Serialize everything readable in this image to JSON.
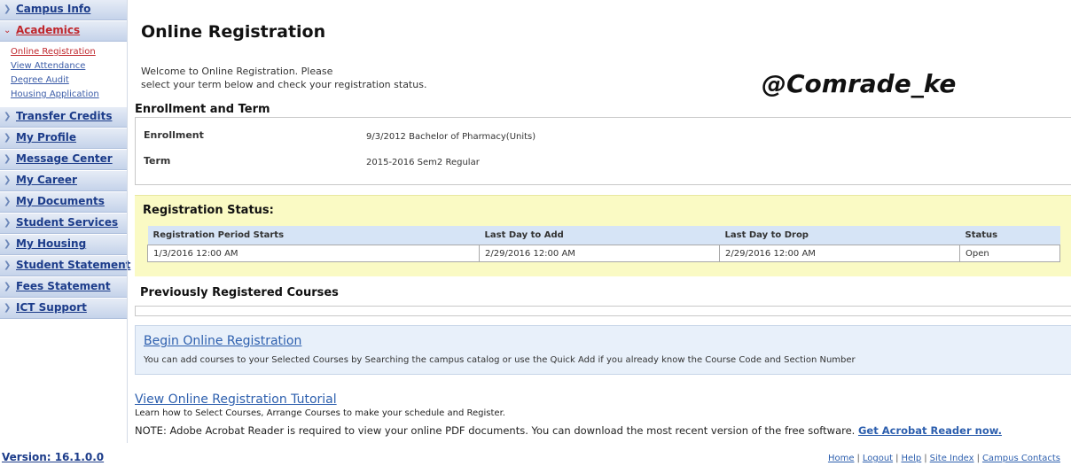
{
  "sidebar": {
    "top_items": [
      {
        "label": "Campus Info"
      },
      {
        "label": "Academics"
      }
    ],
    "academics_sub": [
      {
        "label": "Online Registration"
      },
      {
        "label": "View Attendance"
      },
      {
        "label": "Degree Audit"
      },
      {
        "label": "Housing Application"
      }
    ],
    "items": [
      {
        "label": "Transfer Credits"
      },
      {
        "label": "My Profile"
      },
      {
        "label": "Message Center"
      },
      {
        "label": "My Career"
      },
      {
        "label": "My Documents"
      },
      {
        "label": "Student Services"
      },
      {
        "label": "My Housing"
      },
      {
        "label": "Student Statement"
      },
      {
        "label": "Fees Statement"
      },
      {
        "label": "ICT Support"
      }
    ],
    "version": "Version: 16.1.0.0"
  },
  "main": {
    "title": "Online Registration",
    "welcome_line1": "Welcome to Online Registration. Please",
    "welcome_line2": "select your term below and check your registration status.",
    "watermark": "@Comrade_ke",
    "enrollment": {
      "heading": "Enrollment and Term",
      "enrollment_label": "Enrollment",
      "enrollment_value": "9/3/2012 Bachelor of Pharmacy(Units)",
      "term_label": "Term",
      "term_value": "2015-2016 Sem2 Regular"
    },
    "status": {
      "heading": "Registration Status:",
      "columns": [
        "Registration Period Starts",
        "Last Day to Add",
        "Last Day to Drop",
        "Status"
      ],
      "row": [
        "1/3/2016 12:00 AM",
        "2/29/2016 12:00 AM",
        "2/29/2016 12:00 AM",
        "Open"
      ]
    },
    "previous_heading": "Previously Registered Courses",
    "begin": {
      "link": "Begin Online Registration",
      "desc": "You can add courses to your Selected Courses by Searching the campus catalog or use the Quick Add if you already know the Course Code and Section Number"
    },
    "tutorial": {
      "link": "View Online Registration Tutorial",
      "desc": "Learn how to Select Courses, Arrange Courses to make your schedule and Register."
    },
    "acrobat": {
      "note": "NOTE: Adobe Acrobat Reader is required to view your online PDF documents. You can download the most recent version of the free software.",
      "link": "Get Acrobat Reader now."
    }
  },
  "footer": {
    "links": [
      "Home",
      "Logout",
      "Help",
      "Site Index",
      "Campus Contacts"
    ],
    "separator": "|"
  }
}
